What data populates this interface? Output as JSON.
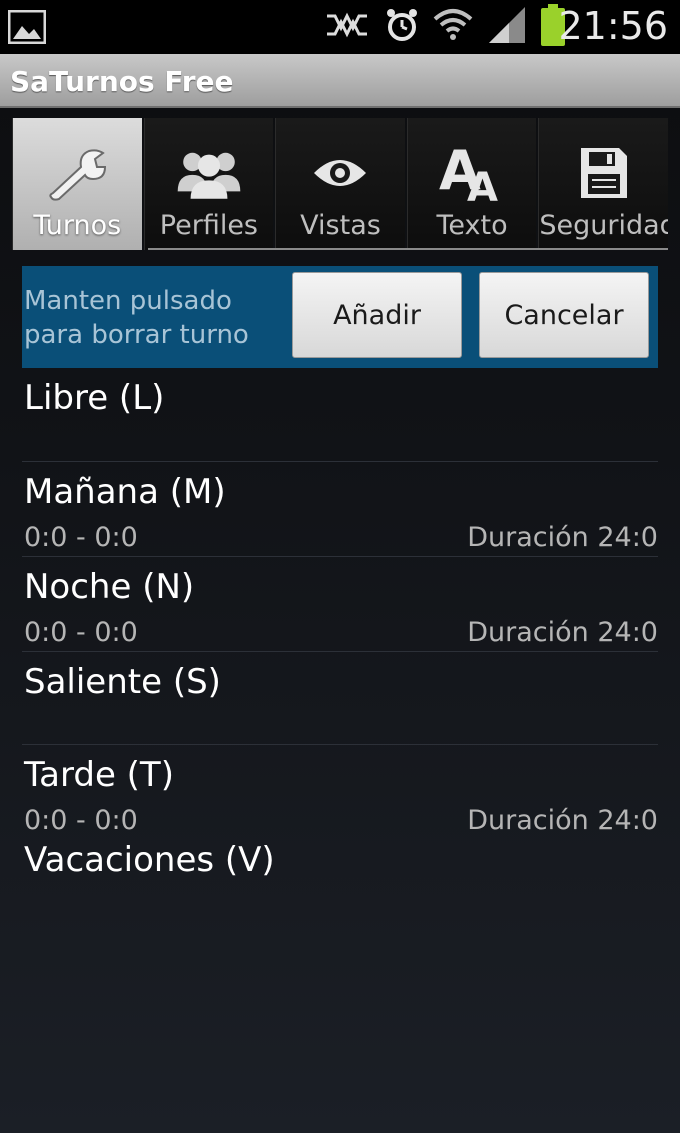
{
  "statusbar": {
    "time": "21:56",
    "icons": [
      "image-icon",
      "nfc-icon",
      "alarm-icon",
      "wifi-icon",
      "signal-icon",
      "battery-icon"
    ]
  },
  "app": {
    "title": "SaTurnos Free"
  },
  "tabs": [
    {
      "label": "Turnos",
      "icon": "wrench-icon",
      "active": true
    },
    {
      "label": "Perfiles",
      "icon": "people-icon",
      "active": false
    },
    {
      "label": "Vistas",
      "icon": "eye-icon",
      "active": false
    },
    {
      "label": "Texto",
      "icon": "text-icon",
      "active": false
    },
    {
      "label": "Seguridad",
      "icon": "save-icon",
      "active": false
    }
  ],
  "actions": {
    "hint": "Manten pulsado para borrar turno",
    "add_label": "Añadir",
    "cancel_label": "Cancelar"
  },
  "shifts": [
    {
      "name": "Libre (L)"
    },
    {
      "name": "Mañana (M)",
      "hours": "0:0 - 0:0",
      "duration": "Duración 24:0"
    },
    {
      "name": "Noche (N)",
      "hours": "0:0 - 0:0",
      "duration": "Duración 24:0"
    },
    {
      "name": "Saliente (S)"
    },
    {
      "name": "Tarde (T)",
      "hours": "0:0 - 0:0",
      "duration": "Duración 24:0"
    },
    {
      "name": "Vacaciones (V)"
    }
  ],
  "colors": {
    "accent_bar": "#0a4f78",
    "battery": "#9ad12b",
    "background": "#111317"
  }
}
